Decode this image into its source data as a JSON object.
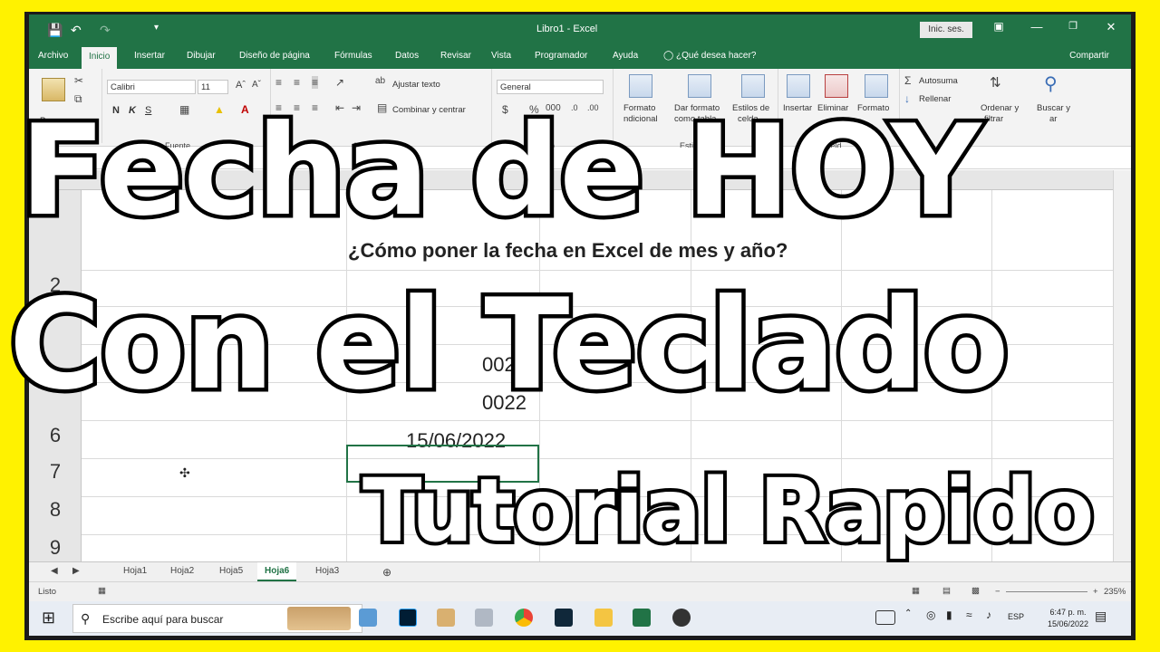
{
  "window": {
    "title": "Libro1  -  Excel",
    "signin": "Inic. ses.",
    "share": "Compartir"
  },
  "tabs": [
    "Archivo",
    "Inicio",
    "Insertar",
    "Dibujar",
    "Diseño de página",
    "Fórmulas",
    "Datos",
    "Revisar",
    "Vista",
    "Programador",
    "Ayuda"
  ],
  "tell_me": "¿Qué desea hacer?",
  "ribbon": {
    "paste": "Pegar",
    "font_name": "Calibri",
    "font_size": "11",
    "bold": "N",
    "italic": "K",
    "underline": "S",
    "wrap_text": "Ajustar texto",
    "merge_center": "Combinar y centrar",
    "number_format": "General",
    "cond_format": "Formato",
    "cond_format2": "ndicional",
    "format_table": "Dar formato",
    "format_table2": "como tabla",
    "cell_styles": "Estilos de",
    "cell_styles2": "celda",
    "insert": "Insertar",
    "delete": "Eliminar",
    "format": "Formato",
    "autosum": "Autosuma",
    "fill": "Rellenar",
    "sort_filter": "Ordenar y",
    "sort_filter2": "filtrar",
    "find_select": "Buscar y",
    "find_select2": "ar",
    "groups": {
      "font": "Fuente",
      "alignment": "Alineación",
      "number": "Número",
      "styles": "Estilos",
      "cells": "Celd"
    }
  },
  "grid": {
    "row_numbers": [
      "2",
      "",
      "",
      "6",
      "7",
      "8",
      "9"
    ],
    "heading_text": "¿Cómo poner la fecha en Excel de mes y año?",
    "cells": {
      "r4": "0022",
      "r5": "0022",
      "r6": "15/06/2022"
    }
  },
  "sheets": [
    "Hoja1",
    "Hoja2",
    "Hoja5",
    "Hoja6",
    "Hoja3"
  ],
  "active_sheet": "Hoja6",
  "status": {
    "ready": "Listo",
    "zoom": "235%"
  },
  "taskbar": {
    "search_placeholder": "Escribe aquí para buscar",
    "language": "ESP",
    "time": "6:47 p. m.",
    "date": "15/06/2022"
  },
  "overlay": {
    "line1": "Fecha de HOY",
    "line2": "Con el Teclado",
    "line3": "Tutorial Rapido"
  },
  "colors": {
    "excel_green": "#217346",
    "frame": "#fff200",
    "overlay_fill": "#ffffff",
    "overlay_stroke": "#000000"
  }
}
